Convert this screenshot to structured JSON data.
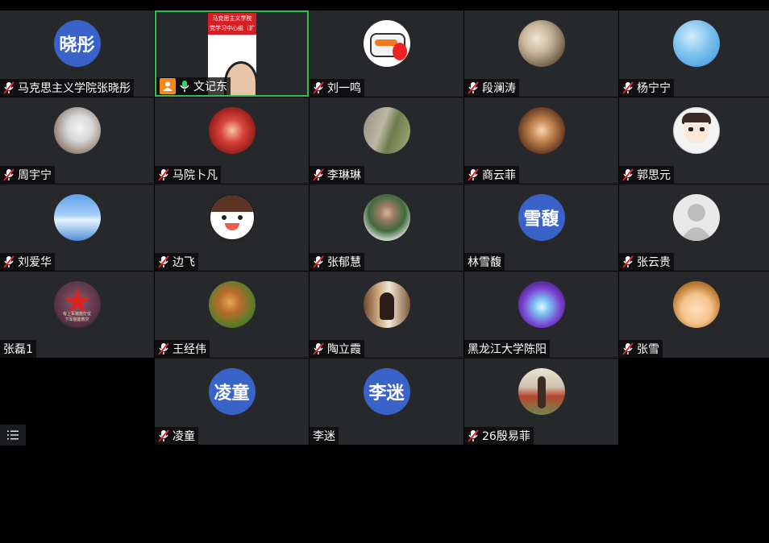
{
  "participants": [
    {
      "name": "马克思主义学院张晓彤",
      "avatar_text": "晓彤",
      "muted": true
    },
    {
      "name": "文记东",
      "muted": false,
      "active": true,
      "host_badge": true,
      "shared_lines": [
        "马克思主义学院",
        "党学习中心组（扩大"
      ]
    },
    {
      "name": "刘一鸣",
      "muted": true
    },
    {
      "name": "段澜涛",
      "muted": true
    },
    {
      "name": "杨宁宁",
      "muted": true
    },
    {
      "name": "周宇宁",
      "muted": true
    },
    {
      "name": "马院卜凡",
      "muted": true
    },
    {
      "name": "李琳琳",
      "muted": true
    },
    {
      "name": "商云菲",
      "muted": true
    },
    {
      "name": "郭思元",
      "muted": true
    },
    {
      "name": "刘爱华",
      "muted": true
    },
    {
      "name": "边飞",
      "muted": true
    },
    {
      "name": "张郁慧",
      "muted": true
    },
    {
      "name": "林雪馥",
      "avatar_text": "雪馥",
      "muted": false
    },
    {
      "name": "张云贵",
      "muted": true
    },
    {
      "name": "张磊1",
      "muted": false,
      "avatar_caption": [
        "有上军装能打仗",
        "下军装能救灾"
      ]
    },
    {
      "name": "王经伟",
      "muted": true
    },
    {
      "name": "陶立霞",
      "muted": true
    },
    {
      "name": "黑龙江大学陈阳",
      "muted": false
    },
    {
      "name": "张雪",
      "muted": true
    },
    {
      "name": "凌童",
      "avatar_text": "凌童",
      "muted": true
    },
    {
      "name": "李迷",
      "avatar_text": "李迷",
      "muted": false
    },
    {
      "name": "26殷易菲",
      "muted": true
    }
  ],
  "colors": {
    "avatar_blue": "#3a63c9",
    "active_border": "#2fbf57",
    "muted_red": "#e0242a",
    "mic_green": "#3ad16a"
  },
  "menu_icon": "list-menu-icon"
}
